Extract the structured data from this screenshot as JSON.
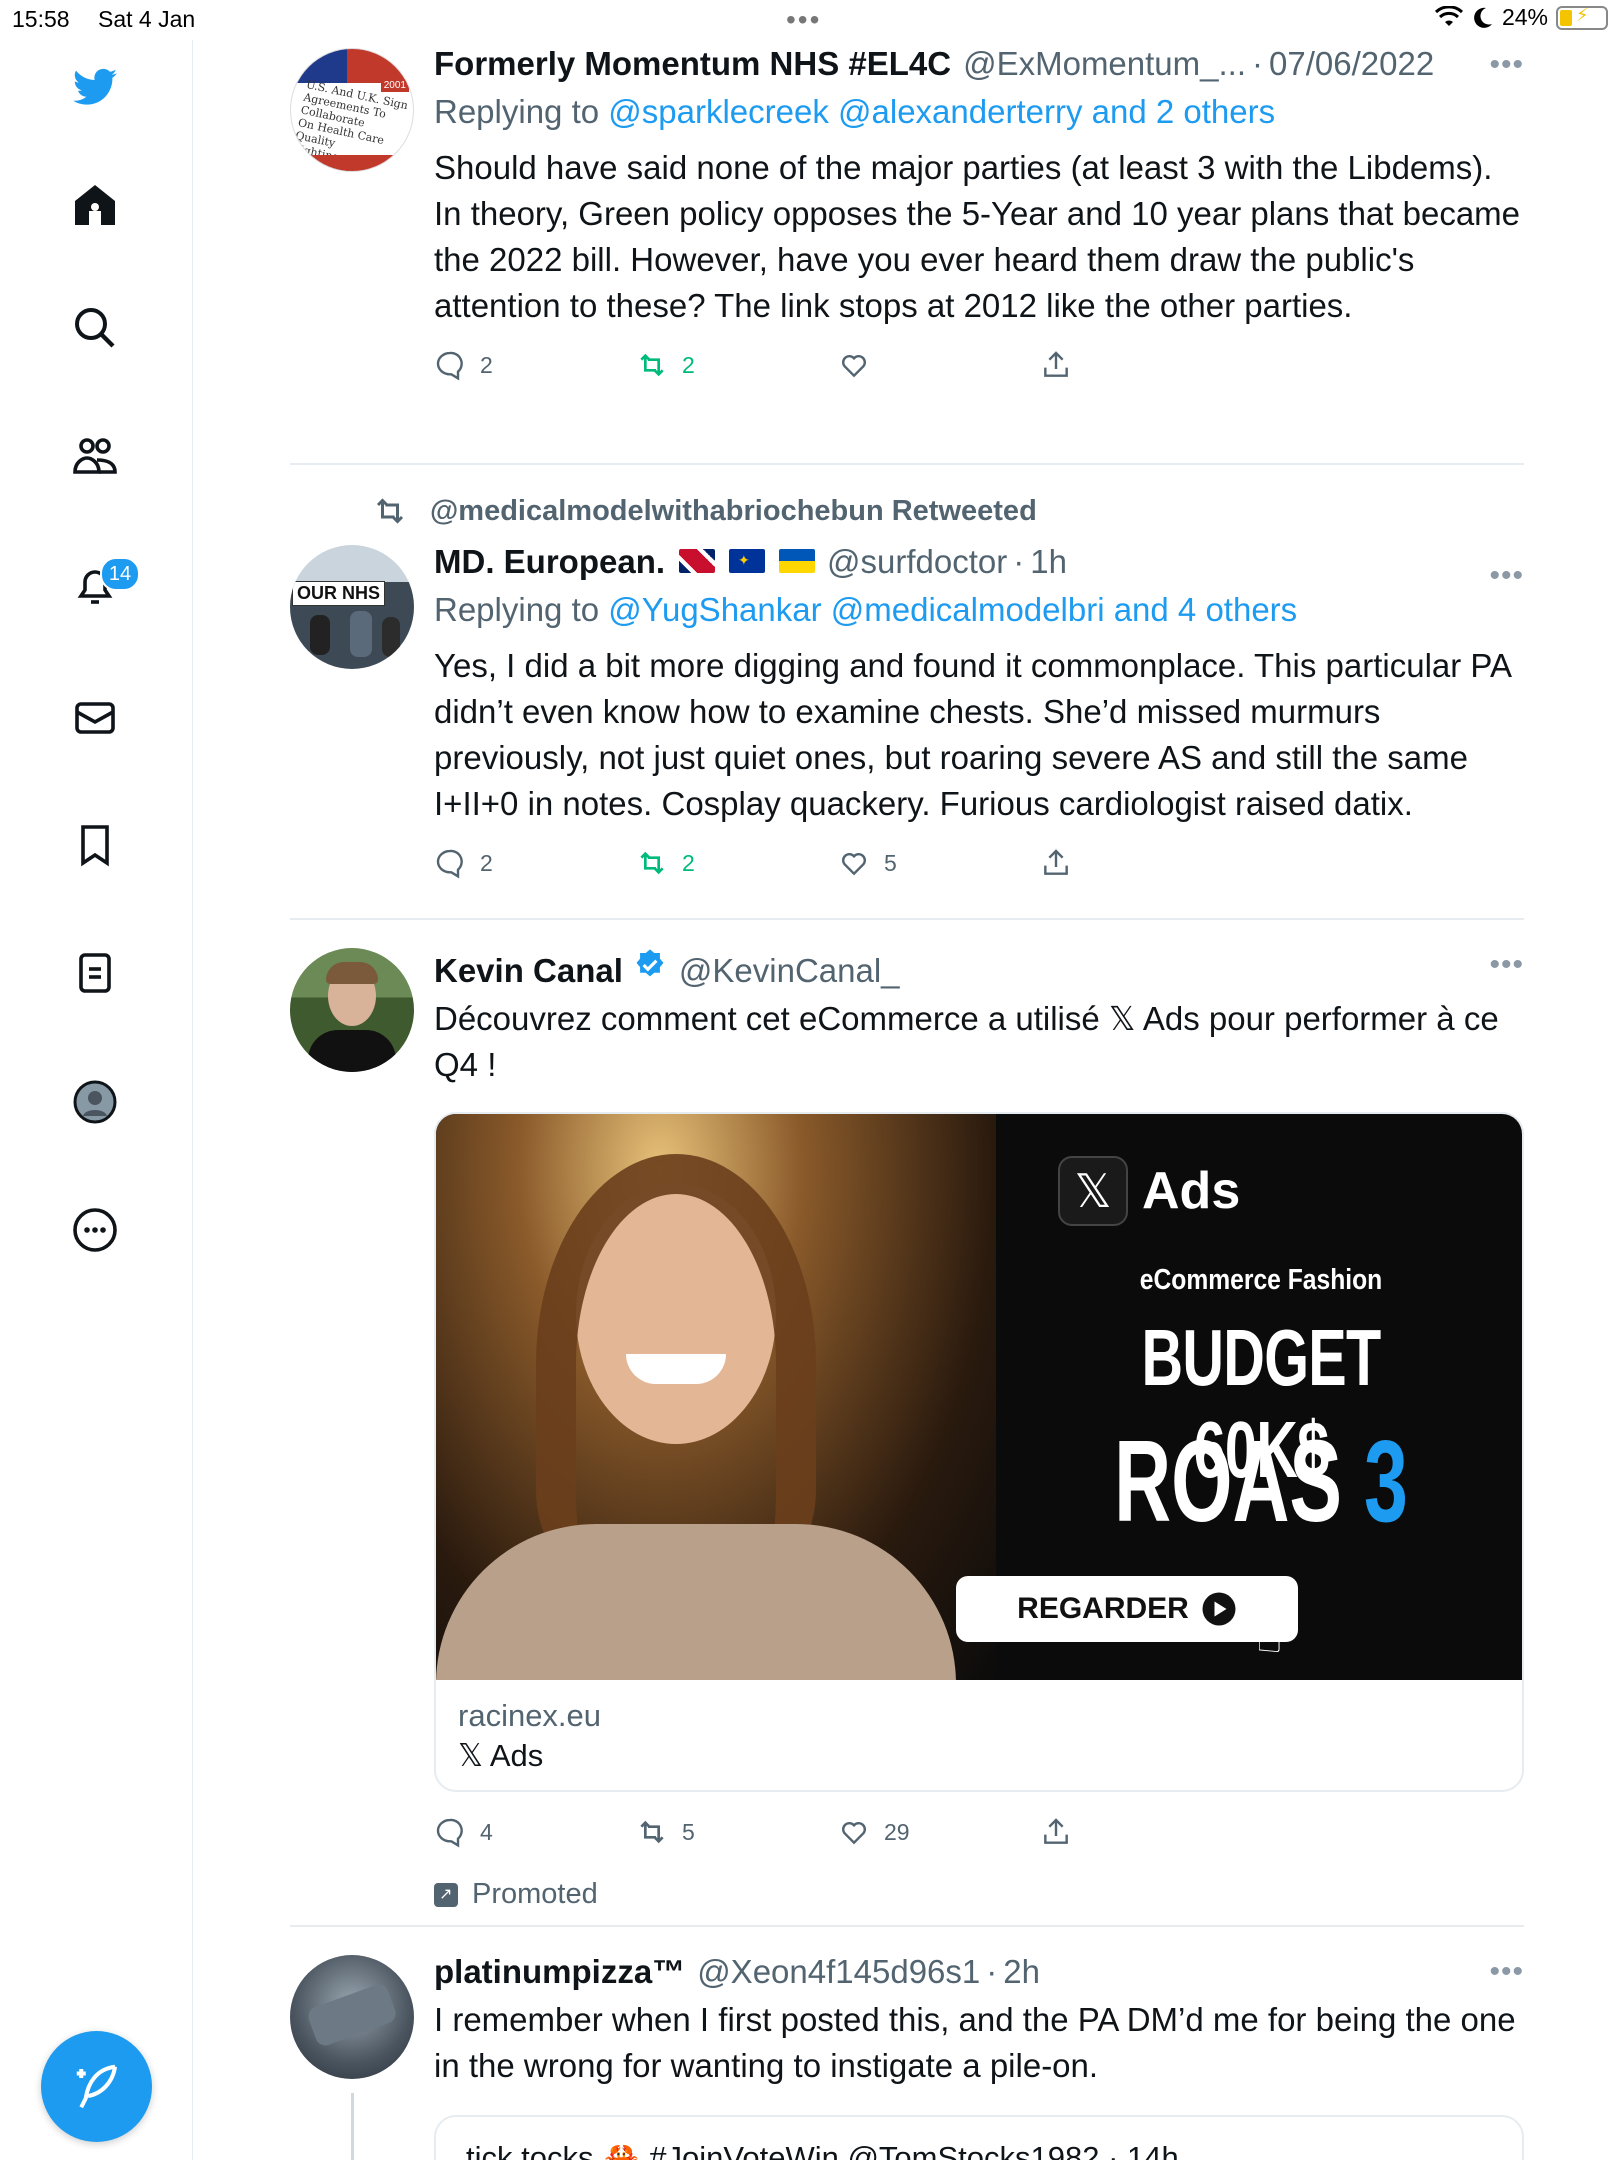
{
  "status": {
    "time": "15:58",
    "date": "Sat 4 Jan",
    "battery": "24%"
  },
  "nav": {
    "notifications_badge": "14"
  },
  "tweets": [
    {
      "name": "Formerly Momentum NHS #EL4C",
      "handle": "@ExMomentum_...",
      "sep": "·",
      "time": "07/06/2022",
      "reply_prefix": "Replying to",
      "reply_to": "@sparklecreek @alexanderterry and 2 others",
      "text": "Should have said none of the major parties (at least 3 with the Libdems). In theory, Green policy opposes the 5-Year and 10 year plans that became the 2022 bill. However, have you ever heard them draw the public's attention to these? The link stops at 2012 like the other parties.",
      "replies": "2",
      "retweets": "2",
      "likes": "",
      "avatar_text": "2001"
    },
    {
      "retweeted_by": "@medicalmodelwithabriochebun Retweeted",
      "name": "MD. European.",
      "handle": "@surfdoctor",
      "sep": "·",
      "time": "1h",
      "reply_prefix": "Replying to",
      "reply_to": "@YugShankar @medicalmodelbri and 4 others",
      "text": "Yes, I did a bit more digging and found it commonplace. This particular PA didn’t even know how to examine chests. She’d missed murmurs previously, not just quiet ones, but roaring severe AS and still the same I+II+0 in notes. Cosplay quackery. Furious cardiologist raised datix.",
      "replies": "2",
      "retweets": "2",
      "likes": "5",
      "avatar_text": "OUR NHS"
    },
    {
      "name": "Kevin Canal",
      "handle": "@KevinCanal_",
      "text": "Découvrez comment cet eCommerce a utilisé 𝕏 Ads pour performer à ce Q4 !",
      "card": {
        "ads_label": "Ads",
        "subtitle": "eCommerce Fashion",
        "line1": "BUDGET 60K$",
        "line2a": "ROAS",
        "line2b": "3",
        "cta": "REGARDER",
        "domain": "racinex.eu",
        "source": "𝕏 Ads"
      },
      "replies": "4",
      "retweets": "5",
      "likes": "29",
      "promoted": "Promoted"
    },
    {
      "name": "platinumpizza™",
      "handle": "@Xeon4f145d96s1",
      "sep": "·",
      "time": "2h",
      "text": "I remember when I first posted this, and the PA DM’d me for being the one in the wrong for wanting to instigate a pile-on.",
      "quote": "tick.tocks 🦀 #JoinVoteWin @TomStocks1982 · 14h"
    }
  ],
  "colors": {
    "accent": "#1d9bf0",
    "retweet_green": "#00ba7c",
    "muted": "#536471"
  }
}
